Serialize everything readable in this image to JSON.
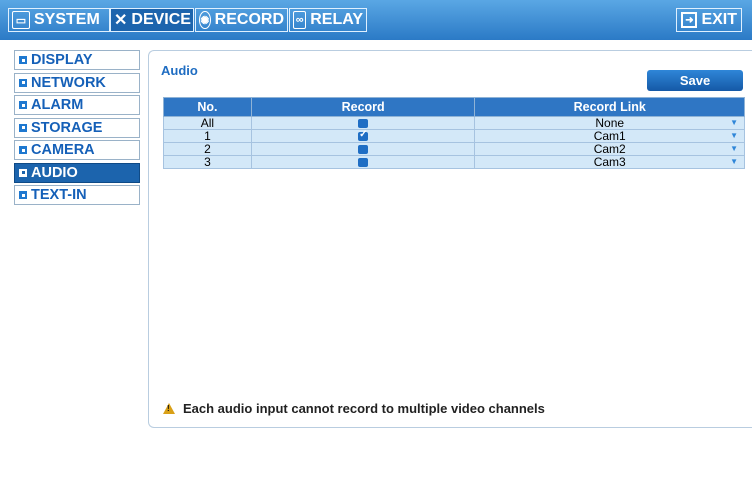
{
  "topbar": {
    "tabs": [
      {
        "label": "SYSTEM",
        "icon": "monitor-icon"
      },
      {
        "label": "DEVICE",
        "icon": "tools-icon"
      },
      {
        "label": "RECORD",
        "icon": "film-reel-icon"
      },
      {
        "label": "RELAY",
        "icon": "relay-icon"
      }
    ],
    "active_tab": "DEVICE",
    "exit_label": "EXIT"
  },
  "sidebar": {
    "items": [
      {
        "label": "DISPLAY"
      },
      {
        "label": "NETWORK"
      },
      {
        "label": "ALARM"
      },
      {
        "label": "STORAGE"
      },
      {
        "label": "CAMERA"
      },
      {
        "label": "AUDIO"
      },
      {
        "label": "TEXT-IN"
      }
    ],
    "active_item": "AUDIO"
  },
  "main": {
    "title": "Audio",
    "save_label": "Save",
    "table": {
      "headers": [
        "No.",
        "Record",
        "Record Link"
      ],
      "rows": [
        {
          "no": "All",
          "record": false,
          "link": "None"
        },
        {
          "no": "1",
          "record": true,
          "link": "Cam1"
        },
        {
          "no": "2",
          "record": false,
          "link": "Cam2"
        },
        {
          "no": "3",
          "record": false,
          "link": "Cam3"
        }
      ]
    },
    "warning": "Each audio input cannot record to multiple video channels"
  },
  "colors": {
    "accent": "#1c64ad",
    "topbar": "#3b8fd6",
    "row_bg": "#d3e8f8",
    "header_bg": "#2f76c4",
    "warning_icon": "#d9a017"
  }
}
